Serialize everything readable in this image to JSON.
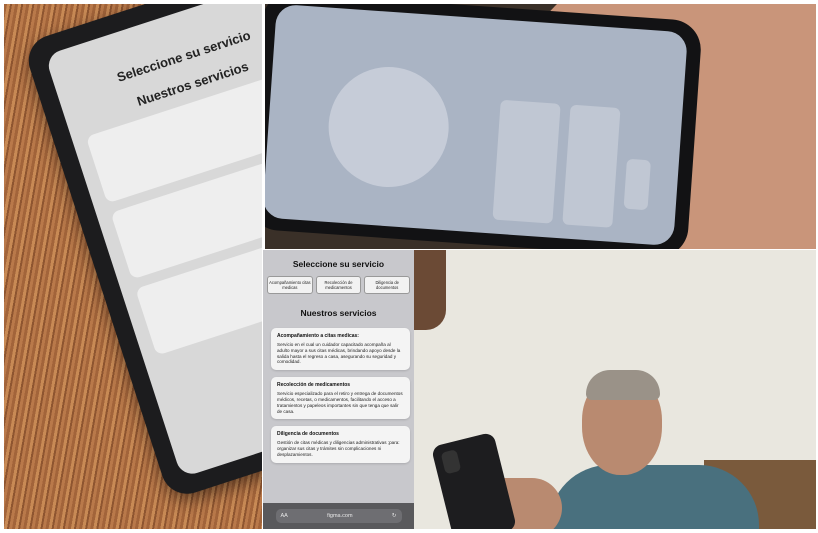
{
  "mockup": {
    "title": "Seleccione su servicio",
    "buttons": [
      "Acompañamiento citas medicas",
      "Recolección de medicamentos",
      "Diligencia de documentos"
    ],
    "section_title": "Nuestros servicios",
    "cards": [
      {
        "title": "Acompañamiento a citas medicas:",
        "description": "Servicio en el cual un cuidador capacitado acompaña al adulto mayor a sus citas médicas, brindando apoyo desde la salida hasta el regreso a casa, asegurando su seguridad y comodidad."
      },
      {
        "title": "Recolección de medicamentos",
        "description": "Servicio especializado para el retiro y entrega de documentos médicos, recetas, o medicamentos, facilitando el acceso a tratamientos y papeleos importantes sin que tenga que salir de casa."
      },
      {
        "title": "Diligencia de documentos",
        "description": "Gestión de citas médicas y diligencias administrativas ;para: organizar sus citas y trámites sin complicaciones ni desplazamientos."
      }
    ],
    "browser": {
      "text_size": "AA",
      "url": "figma.com",
      "reload_icon": "reload-icon"
    }
  },
  "tablet_photo": {
    "title": "Seleccione su servicio",
    "section_title": "Nuestros servicios"
  }
}
